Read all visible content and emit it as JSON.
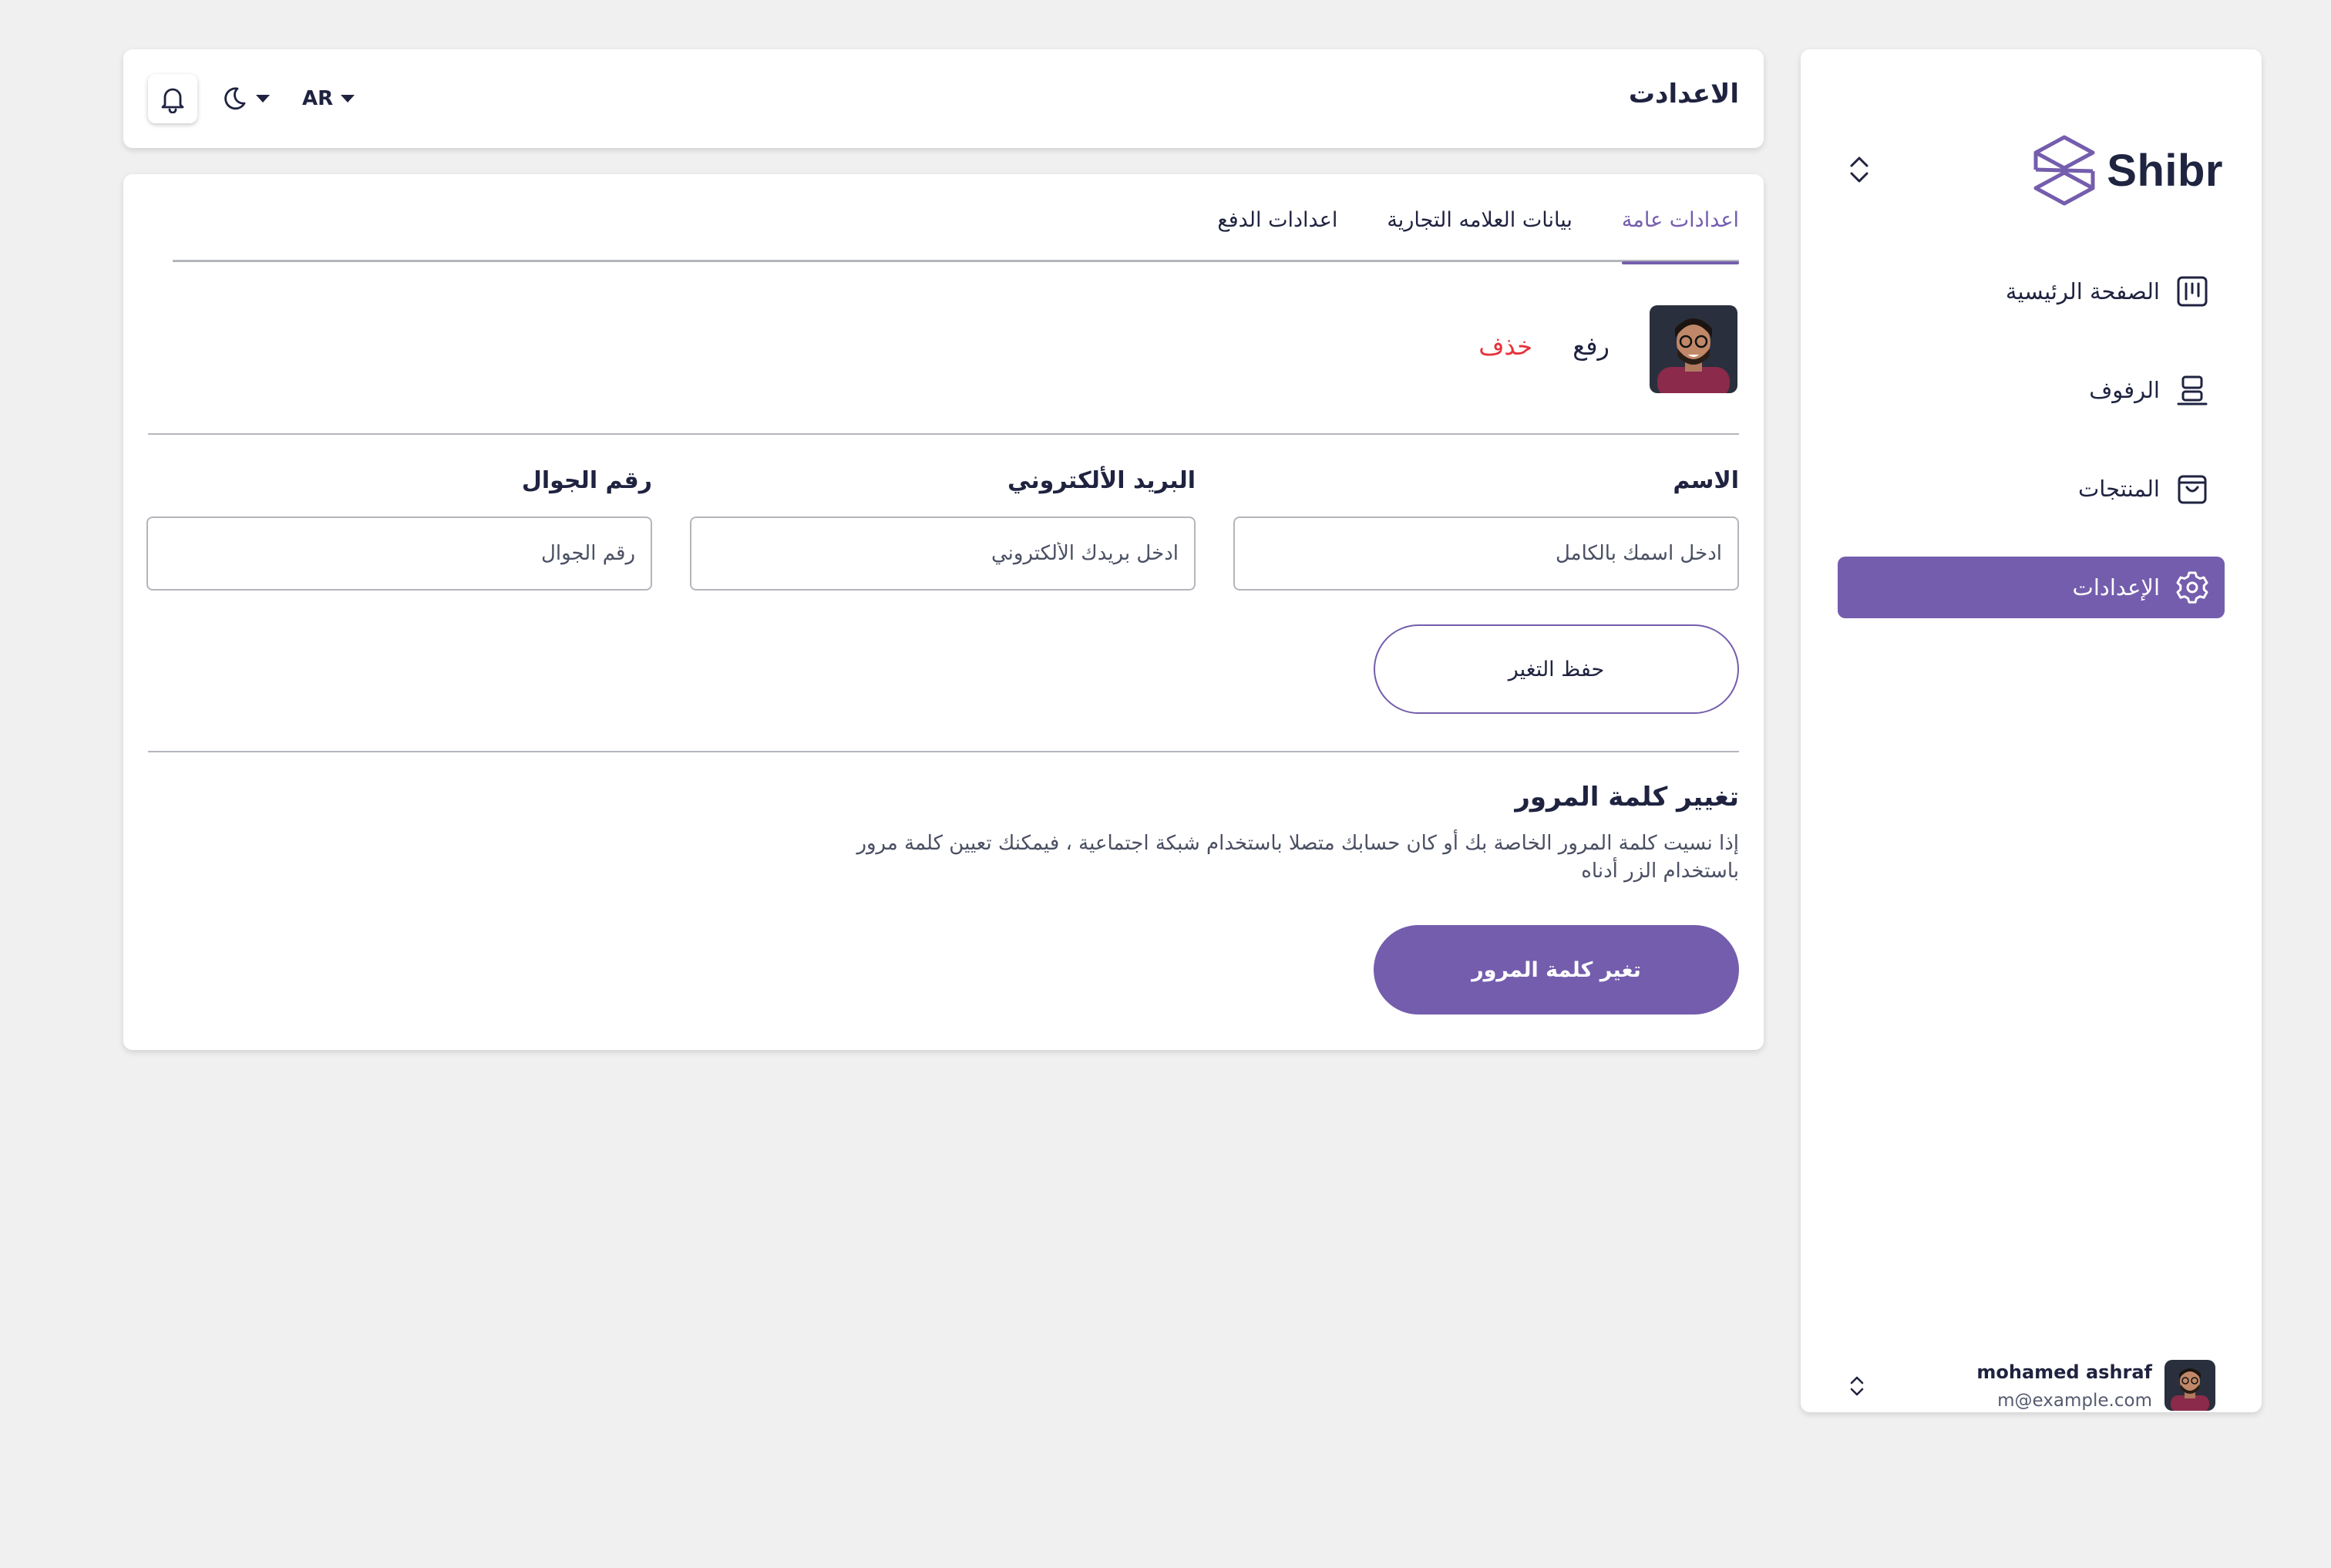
{
  "app": {
    "brand": "Shibr",
    "accent_color": "#745dad",
    "danger_color": "#e6323a"
  },
  "sidebar": {
    "items": [
      {
        "label": "الصفحة الرئيسية",
        "icon": "dashboard-icon",
        "active": false
      },
      {
        "label": "الرفوف",
        "icon": "shelf-icon",
        "active": false
      },
      {
        "label": "المنتجات",
        "icon": "shopping-bag-icon",
        "active": false
      },
      {
        "label": "الإعدادات",
        "icon": "gear-icon",
        "active": true
      }
    ],
    "user": {
      "name": "mohamed ashraf",
      "email": "m@example.com"
    }
  },
  "topbar": {
    "title": "الاعدادت",
    "language": "AR",
    "icons": [
      "bell-icon",
      "moon-icon"
    ]
  },
  "tabs": [
    {
      "label": "اعدادات عامة",
      "active": true
    },
    {
      "label": "بيانات العلامه التجارية",
      "active": false
    },
    {
      "label": "اعدادات الدفع",
      "active": false
    }
  ],
  "profile": {
    "upload_label": "رفع",
    "delete_label": "خذف"
  },
  "form": {
    "name": {
      "label": "الاسم",
      "placeholder": "ادخل اسمك بالكامل",
      "value": ""
    },
    "email": {
      "label": "البريد الألكتروني",
      "placeholder": "ادخل بريدك الألكتروني",
      "value": ""
    },
    "phone": {
      "label": "رقم الجوال",
      "placeholder": "رقم الجوال",
      "value": ""
    },
    "save_label": "حفظ التغير"
  },
  "password": {
    "title": "تغيير كلمة المرور",
    "description": "إذا نسيت كلمة المرور الخاصة بك أو كان حسابك متصلا باستخدام شبكة اجتماعية ، فيمكنك تعيين كلمة مرور باستخدام الزر أدناه",
    "button_label": "تغير كلمة المرور"
  }
}
